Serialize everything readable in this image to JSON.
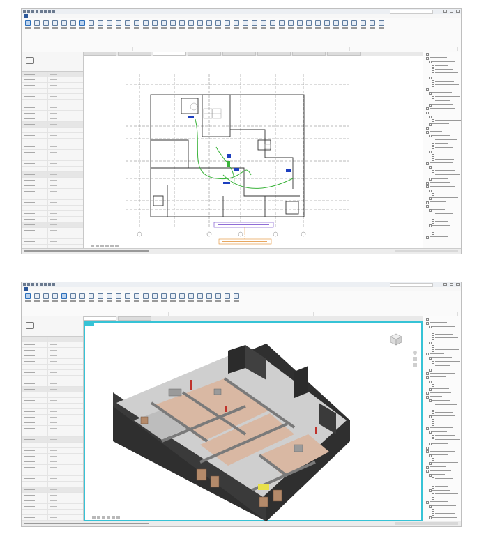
{
  "screens": [
    {
      "view": "plan",
      "statusbar_zoom": "1 : 100"
    },
    {
      "view": "3d",
      "statusbar_zoom": "1 : 100"
    }
  ],
  "colors": {
    "ribbon_active": "#2b579a",
    "view_border": "#36c3d6",
    "floor": "#d9b8a3",
    "wall_dark": "#2f2f2f",
    "wall_grey": "#8a8a8a",
    "accent_green": "#3ab33a",
    "accent_blue": "#1d3fbf",
    "accent_yellow": "#e8e04a",
    "accent_red": "#c0322b"
  },
  "icons": [
    "revit-app-icon",
    "quick-access-icon",
    "view-cube-icon",
    "navigation-bar-icon",
    "project-browser-tree-icon"
  ]
}
